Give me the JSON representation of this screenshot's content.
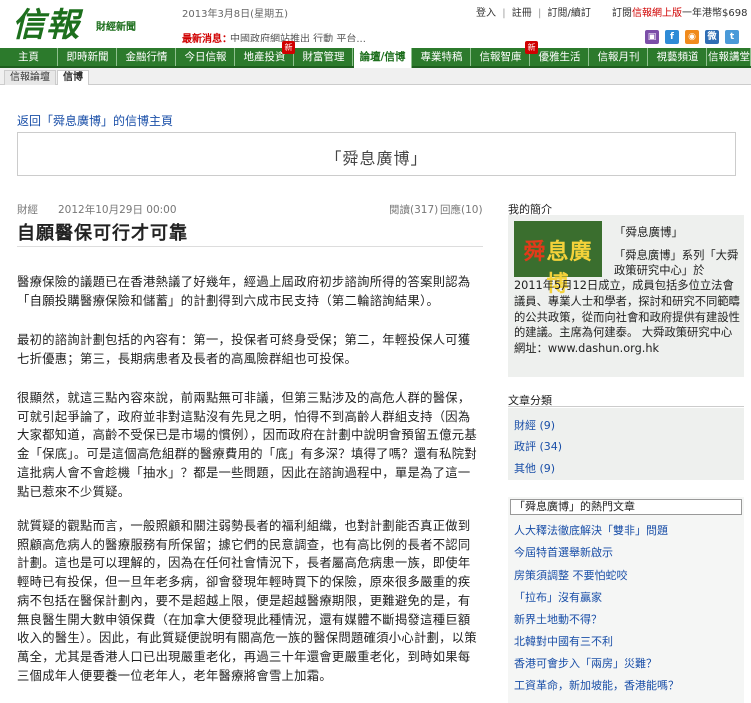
{
  "header": {
    "logo_main": "信報",
    "logo_sub": "財經新聞",
    "date": "2013年3月8日(星期五)",
    "links": [
      "登入",
      "註冊",
      "訂閱/續訂"
    ],
    "promo_prefix": "訂閱",
    "promo_red": "信報網上版",
    "promo_suffix": "一年港幣$698",
    "news_label": "最新消息：",
    "news_text": "中國政府網站推出 行動 平台...",
    "social_icons": [
      "bookmark-icon",
      "facebook-icon",
      "rss-icon",
      "weibo-icon",
      "twitter-icon",
      "social-icon"
    ]
  },
  "nav": {
    "items": [
      "主頁",
      "即時新聞",
      "金融行情",
      "今日信報",
      "地產投資",
      "財富管理",
      "論壇/信博",
      "專業特稿",
      "信報智庫",
      "優雅生活",
      "信報月刊",
      "視藝頻道",
      "信報講堂"
    ],
    "badge": "新",
    "active": "論壇/信博"
  },
  "subnav": {
    "items": [
      "信報論壇",
      "信博"
    ],
    "active": "信博"
  },
  "backlink": "返回「舜息廣博」的信博主頁",
  "banner_title": "「舜息廣博」",
  "article": {
    "category": "財經",
    "date": "2012年10月29日 00:00",
    "reads": "閱讀(317)",
    "replies": "回應(10)",
    "title": "自願醫保可行才可靠",
    "paragraphs": [
      "醫療保險的議題已在香港熱議了好幾年，經過上屆政府初步諮詢所得的答案則認為「自願投購醫療保險和儲蓄」的計劃得到六成市民支持（第二輪諮詢結果）。",
      "最初的諮詢計劃包括的內容有：第一，投保者可終身受保；第二，年輕投保人可獲七折優惠；第三，長期病患者及長者的高風險群組也可投保。",
      "很顯然，就這三點內容來說，前兩點無可非議，但第三點涉及的高危人群的醫保，可就引起爭論了，政府並非對這點沒有先見之明，怕得不到高齡人群組支持（因為大家都知道，高齡不受保已是市場的慣例），因而政府在計劃中說明會預留五億元基金「保底」。可是這個高危組群的醫療費用的「底」有多深？填得了嗎？還有私院對這批病人會不會趁機「抽水」？都是一些問題，因此在諮詢過程中，單是為了這一點已惹來不少質疑。",
      "就質疑的觀點而言，一般照顧和關注弱勢長者的福利組織，也對計劃能否真正做到照顧高危病人的醫療服務有所保留；據它們的民意調查，也有高比例的長者不認同計劃。這也是可以理解的，因為在任何社會情況下，長者屬高危病患一族，即使年輕時已有投保，但一旦年老多病，卻會發現年輕時買下的保險，原來很多嚴重的疾病不包括在醫保計劃內，要不是超越上限，便是超越醫療期限，更難避免的是，有無良醫生開大數申領保費（在加拿大便發現此種情況，還有媒體不斷揭發這種巨額收入的醫生）。因此，有此質疑便說明有關高危一族的醫保問題確須小心計劃，以策萬全，尤其是香港人口已出現嚴重老化，再過三十年還會更嚴重老化，到時如果每三個成年人便要養一位老年人，老年醫療將會雪上加霜。"
    ]
  },
  "sidebar": {
    "profile_heading": "我的簡介",
    "profile_image_text_red": "舜",
    "profile_image_text": "息廣博",
    "profile_name": "「舜息廣博」",
    "profile_desc_a": "「舜息廣博」系列「大舜政策研究中心」於",
    "profile_desc_b": "2011年5月12日成立，成員包括多位立法會議員、專業人士和學者，探討和研究不同範疇的公共政策，從而向社會和政府提供有建設性的建議。主席為何建泰。 大舜政策研究中心網址：www.dashun.org.hk",
    "categories_heading": "文章分類",
    "categories": [
      "財經 (9)",
      "政評 (34)",
      "其他 (9)"
    ],
    "hot_heading": "「舜息廣博」的熱門文章",
    "hot_articles": [
      "人大釋法徹底解決「雙非」問題",
      "今屆特首選舉新啟示",
      "房策須調整 不要怕蛇咬",
      "「拉布」沒有贏家",
      "新界土地動不得？",
      "北韓對中國有三不利",
      "香港可會步入「兩房」災難？",
      "工資革命，新加坡能，香港能嗎？"
    ]
  }
}
